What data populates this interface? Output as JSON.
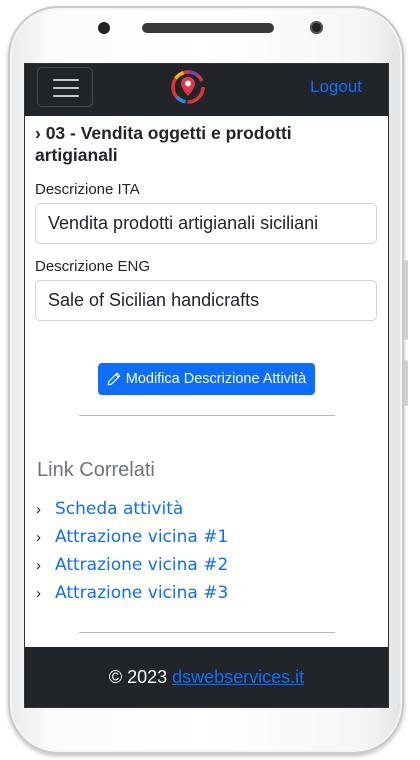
{
  "navbar": {
    "logout_label": "Logout"
  },
  "main": {
    "section_title": "› 03 - Vendita oggetti e prodotti artigianali",
    "fields": [
      {
        "label": "Descrizione ITA",
        "value": "Vendita prodotti artigianali siciliani"
      },
      {
        "label": "Descrizione ENG",
        "value": "Sale of Sicilian handicrafts"
      }
    ],
    "edit_button_label": "Modifica Descrizione Attività"
  },
  "related": {
    "title": "Link Correlati",
    "bullet": "›",
    "links": [
      {
        "label": "Scheda attività"
      },
      {
        "label": "Attrazione vicina #1"
      },
      {
        "label": "Attrazione vicina #2"
      },
      {
        "label": "Attrazione vicina #3"
      }
    ]
  },
  "footer": {
    "copyright": "© 2023",
    "link_label": "dswebservices.it"
  },
  "colors": {
    "navbar_bg": "#212529",
    "primary": "#0d6efd",
    "muted": "#6c757d"
  },
  "icons": {
    "menu": "hamburger-icon",
    "brand": "map-pin-logo",
    "edit": "pencil-icon"
  }
}
